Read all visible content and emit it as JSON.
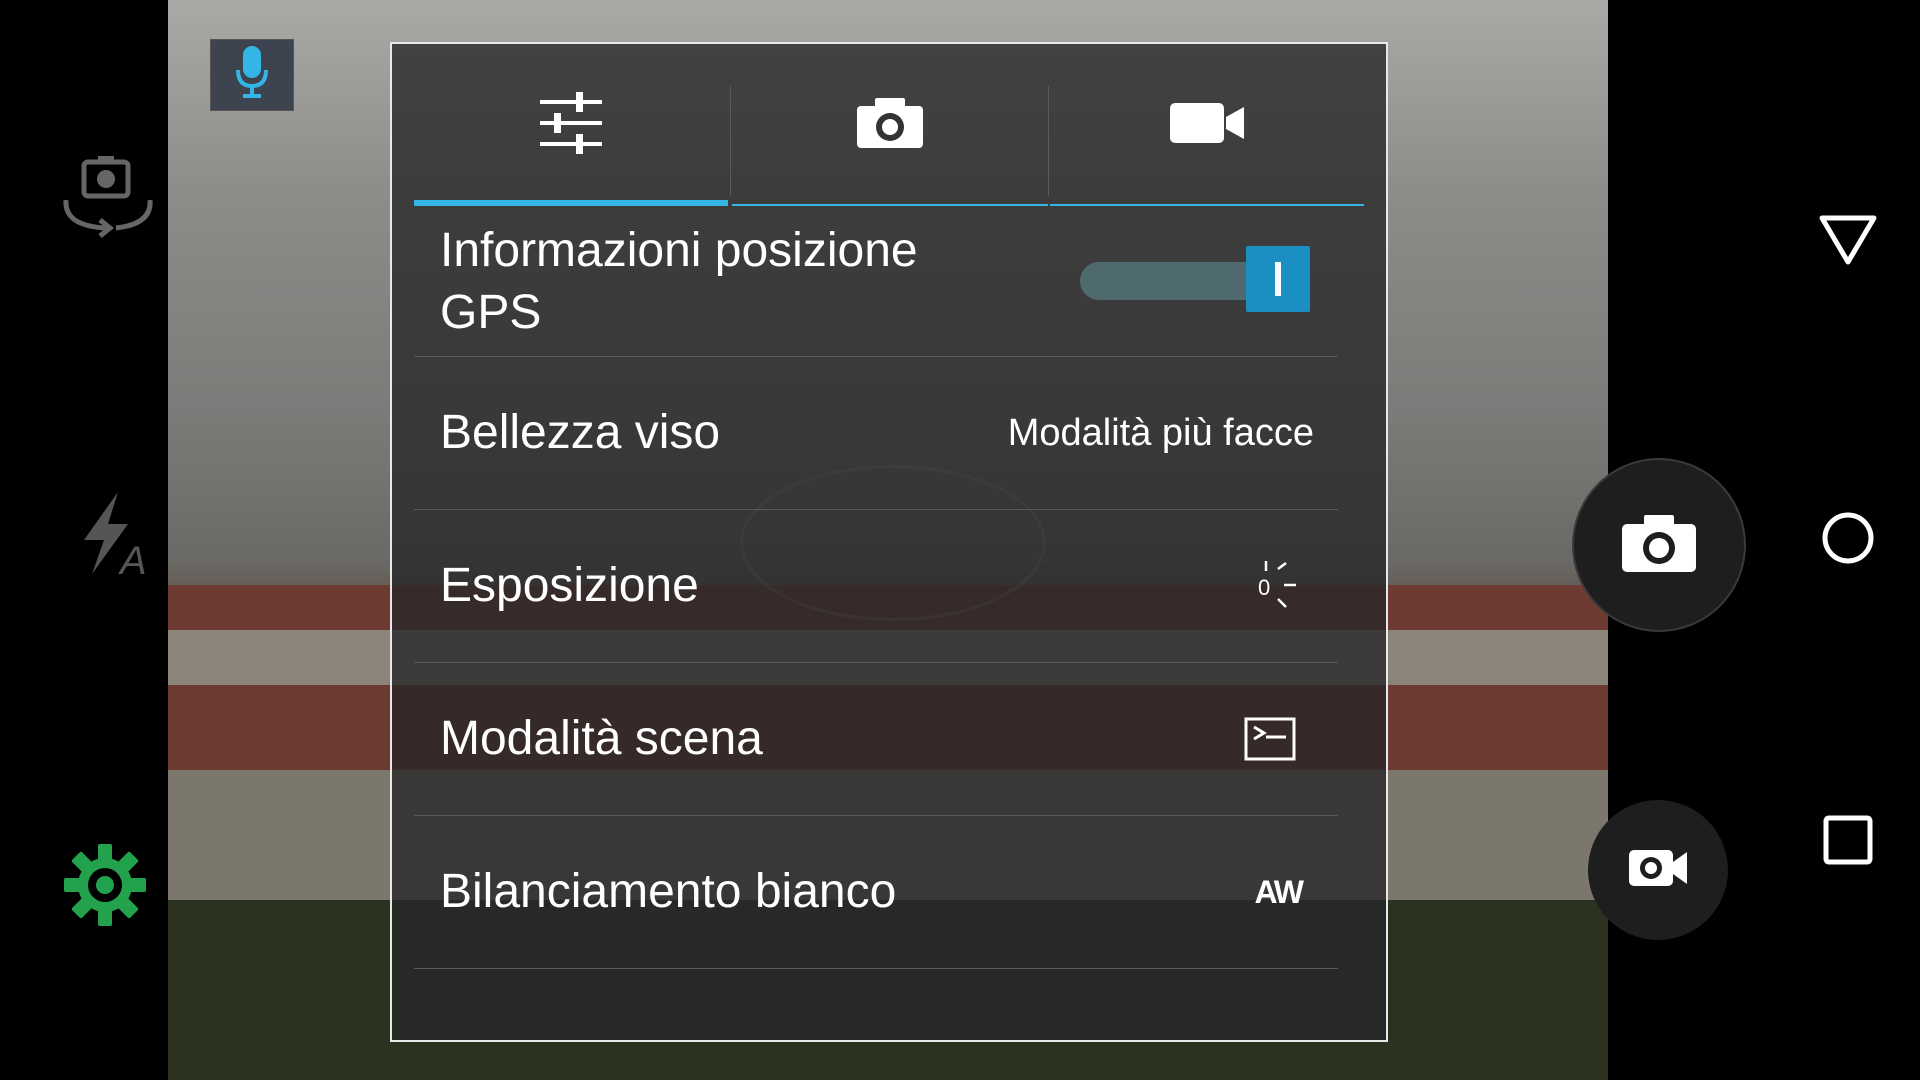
{
  "camera_panel": {
    "tabs": [
      {
        "name": "tab-general-settings",
        "icon": "sliders-icon"
      },
      {
        "name": "tab-photo-settings",
        "icon": "camera-icon"
      },
      {
        "name": "tab-video-settings",
        "icon": "video-camera-icon"
      }
    ],
    "active_tab": 0,
    "settings": [
      {
        "label_line1": "Informazioni posizione",
        "label_line2": "GPS",
        "control": "toggle",
        "enabled": true
      },
      {
        "label": "Bellezza viso",
        "value": "Modalità più facce"
      },
      {
        "label": "Esposizione",
        "value_icon": "exposure-icon",
        "value_text": "0"
      },
      {
        "label": "Modalità scena",
        "value_icon": "scene-mode-icon"
      },
      {
        "label": "Bilanciamento bianco",
        "value_icon": "auto-white-balance-icon",
        "value_text": "AW"
      }
    ]
  },
  "colors": {
    "accent": "#33b5e5",
    "settings_green": "#23a24d",
    "panel_border": "#e8e8e8"
  },
  "left_rail": {
    "icons": [
      "microphone-icon",
      "switch-camera-icon",
      "flash-auto-icon",
      "settings-gear-icon"
    ]
  },
  "right_rail": {
    "icons": [
      "shutter-camera-icon",
      "record-video-icon",
      "nav-back-icon",
      "nav-home-icon",
      "nav-recents-icon"
    ]
  }
}
